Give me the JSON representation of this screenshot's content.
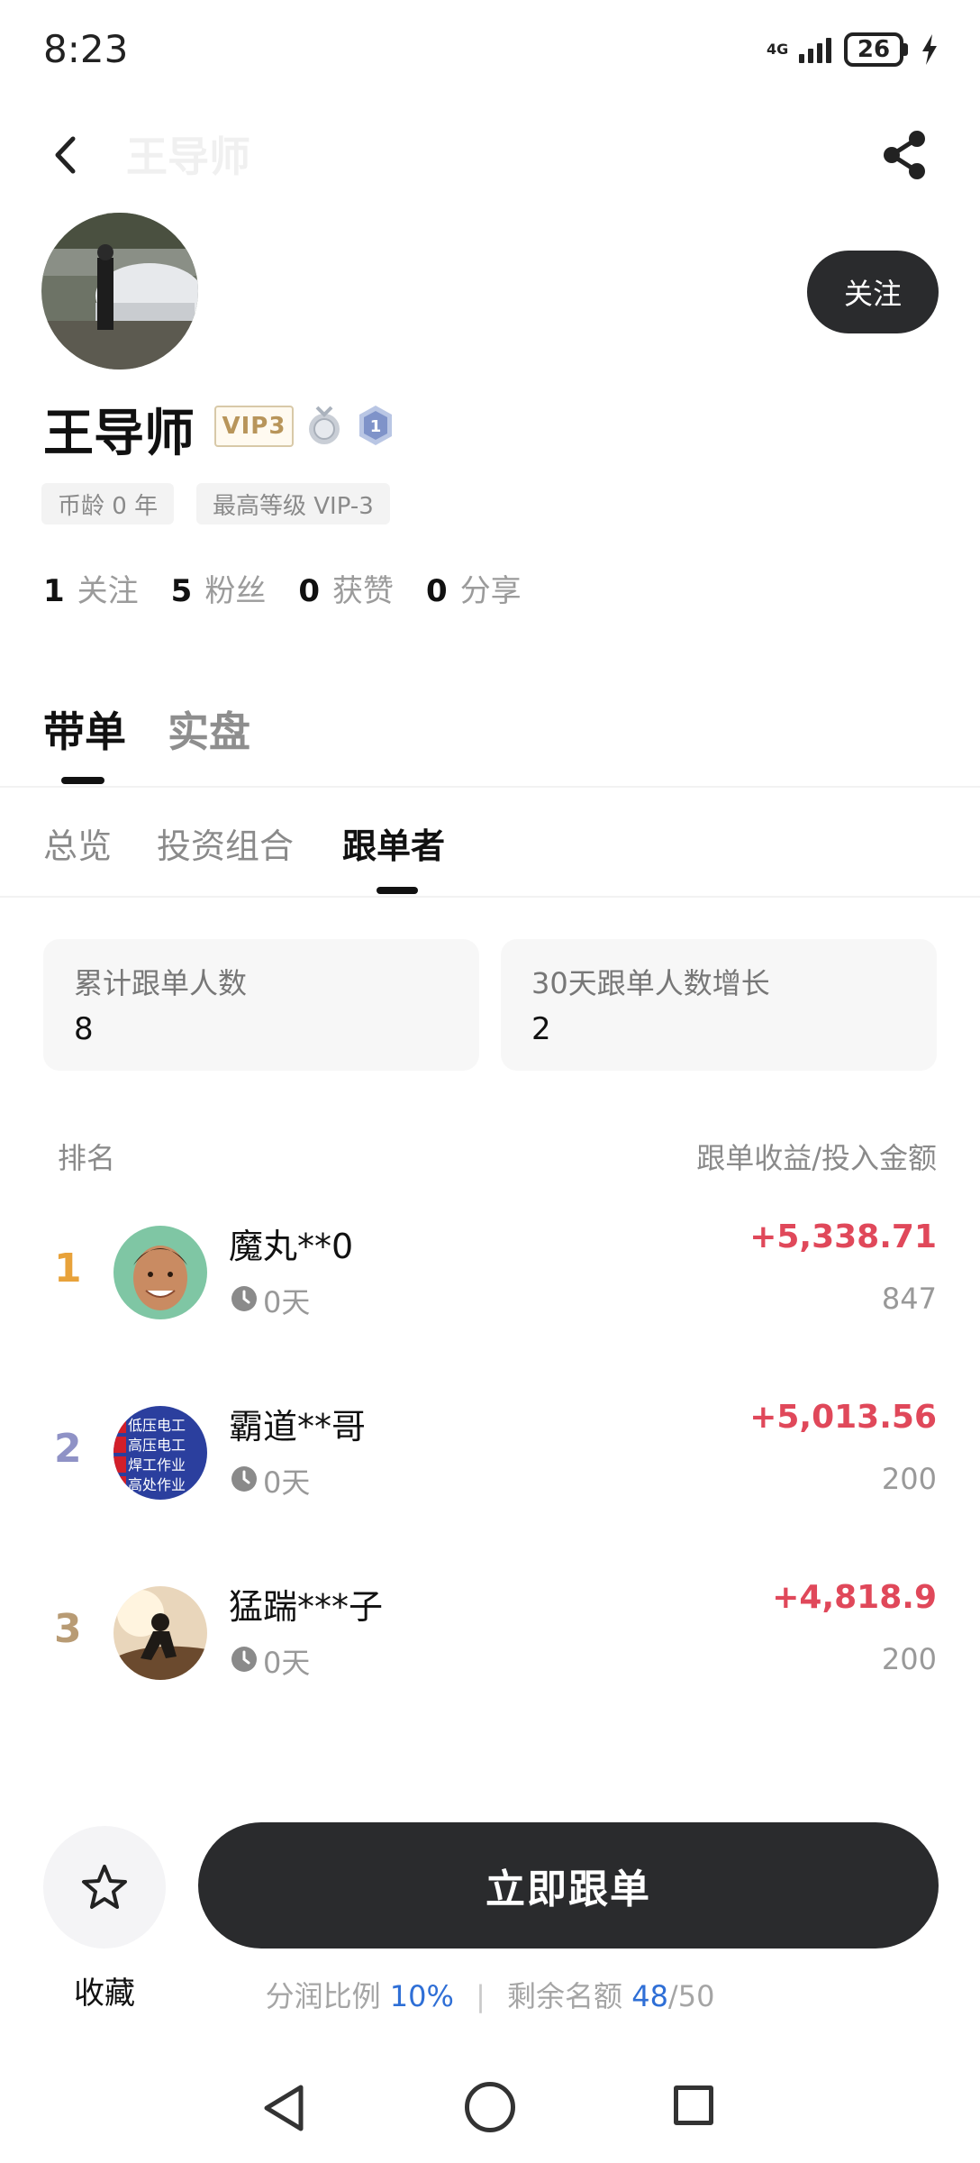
{
  "status_bar": {
    "time": "8:23",
    "network": "4G",
    "battery": "26"
  },
  "header": {
    "title": "王导师"
  },
  "profile": {
    "name": "王导师",
    "vip_badge": "VIP3",
    "medal_level": "1",
    "tags": [
      "币龄 0 年",
      "最高等级 VIP-3"
    ],
    "follow_label": "关注",
    "stats": [
      {
        "value": "1",
        "label": "关注"
      },
      {
        "value": "5",
        "label": "粉丝"
      },
      {
        "value": "0",
        "label": "获赞"
      },
      {
        "value": "0",
        "label": "分享"
      }
    ]
  },
  "main_tabs": [
    {
      "label": "带单"
    },
    {
      "label": "实盘"
    }
  ],
  "sub_tabs": [
    {
      "label": "总览"
    },
    {
      "label": "投资组合"
    },
    {
      "label": "跟单者"
    }
  ],
  "summary": [
    {
      "label": "累计跟单人数",
      "value": "8"
    },
    {
      "label": "30天跟单人数增长",
      "value": "2"
    }
  ],
  "ranking": {
    "header_left": "排名",
    "header_right": "跟单收益/投入金额",
    "rank_colors": [
      "#e8a23a",
      "#8f92c6",
      "#b89b74"
    ],
    "rows": [
      {
        "rank": "1",
        "name": "魔丸**0",
        "days": "0天",
        "profit": "+5,338.71",
        "amount": "847"
      },
      {
        "rank": "2",
        "name": "霸道**哥",
        "days": "0天",
        "profit": "+5,013.56",
        "amount": "200"
      },
      {
        "rank": "3",
        "name": "猛踹***子",
        "days": "0天",
        "profit": "+4,818.9",
        "amount": "200"
      }
    ]
  },
  "avatar2_lines": [
    "低压电工",
    "高压电工",
    "焊工作业",
    "高处作业"
  ],
  "bottom": {
    "favorite_label": "收藏",
    "cta_label": "立即跟单",
    "share_ratio_label": "分润比例",
    "share_ratio_value": "10%",
    "quota_label": "剩余名额",
    "quota_used": "48",
    "quota_total": "/50"
  },
  "colors": {
    "accent_dark": "#2a2b2d",
    "profit_red": "#e0485a",
    "link_blue": "#2f6fd6"
  }
}
